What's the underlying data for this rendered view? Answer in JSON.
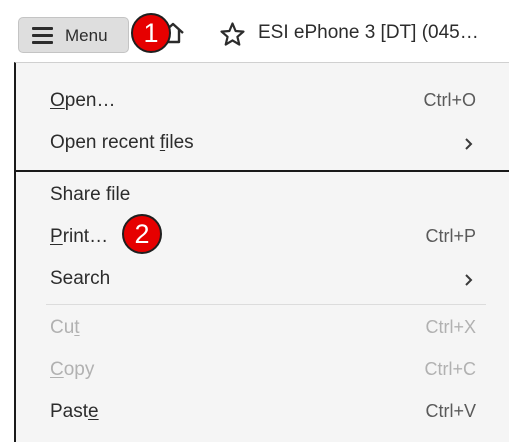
{
  "topbar": {
    "menu_label": "Menu",
    "menu_icon": "hamburger-icon",
    "home_icon": "home-icon",
    "star_icon": "star-icon",
    "document_title": "ESI ePhone 3 [DT] (045…"
  },
  "callouts": [
    "1",
    "2"
  ],
  "menu": {
    "items": [
      {
        "pre": "",
        "ul": "O",
        "post": "pen…",
        "shortcut": "Ctrl+O",
        "submenu": false,
        "disabled": false
      },
      {
        "pre": "Open recent ",
        "ul": "f",
        "post": "iles",
        "shortcut": "",
        "submenu": true,
        "disabled": false
      },
      {
        "pre": "Share file",
        "ul": "",
        "post": "",
        "shortcut": "",
        "submenu": false,
        "disabled": false
      },
      {
        "pre": "",
        "ul": "P",
        "post": "rint…",
        "shortcut": "Ctrl+P",
        "submenu": false,
        "disabled": false
      },
      {
        "pre": "Search",
        "ul": "",
        "post": "",
        "shortcut": "",
        "submenu": true,
        "disabled": false
      },
      {
        "pre": "Cu",
        "ul": "t",
        "post": "",
        "shortcut": "Ctrl+X",
        "submenu": false,
        "disabled": true
      },
      {
        "pre": "",
        "ul": "C",
        "post": "opy",
        "shortcut": "Ctrl+C",
        "submenu": false,
        "disabled": true
      },
      {
        "pre": "Past",
        "ul": "e",
        "post": "",
        "shortcut": "Ctrl+V",
        "submenu": false,
        "disabled": false
      }
    ],
    "chevron_icon": "chevron-right-icon"
  },
  "colors": {
    "callout_red": "#e60000",
    "menu_bg": "#f5f5f5",
    "disabled_text": "#b1b1b1"
  }
}
